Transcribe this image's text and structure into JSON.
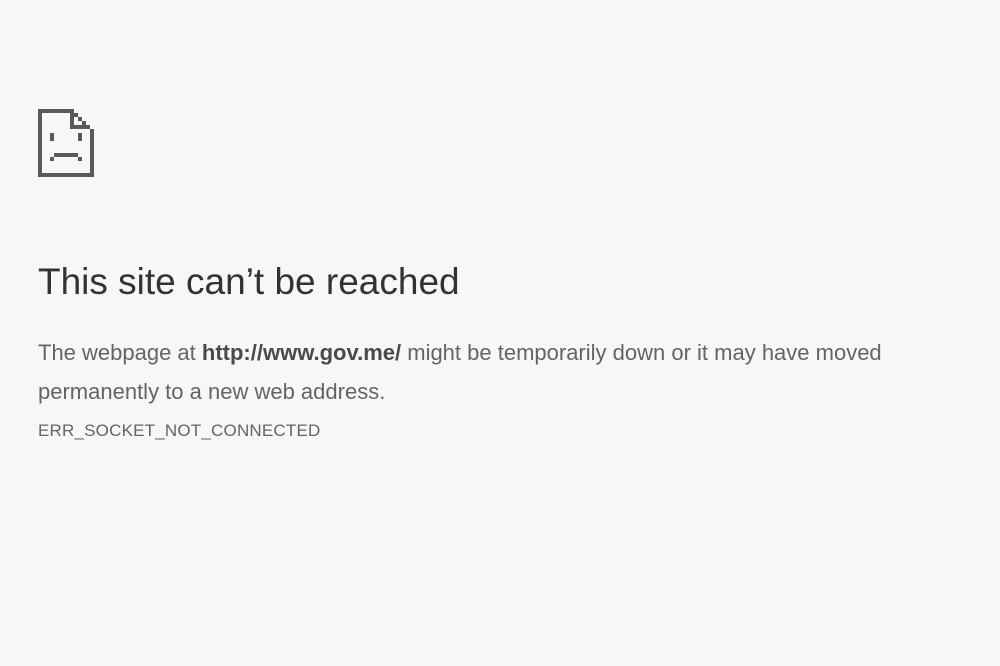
{
  "icon": "sad-page-icon",
  "heading": "This site can’t be reached",
  "description": {
    "prefix": "The webpage at ",
    "url": "http://www.gov.me/",
    "suffix_line1": " might be temporarily down or it may have moved",
    "line2": "permanently to a new web address."
  },
  "error_code": "ERR_SOCKET_NOT_CONNECTED",
  "colors": {
    "background": "#f7f7f7",
    "heading_text": "#333333",
    "body_text": "#646464",
    "icon": "#5a5a5a"
  }
}
